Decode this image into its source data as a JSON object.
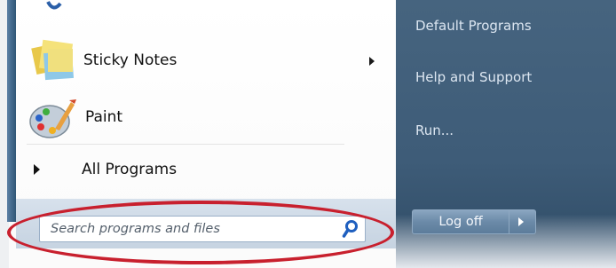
{
  "programs": {
    "sticky_notes": {
      "label": "Sticky Notes",
      "icon": "sticky-notes-icon"
    },
    "paint": {
      "label": "Paint",
      "icon": "paint-palette-icon"
    },
    "all_programs": {
      "label": "All Programs"
    }
  },
  "search": {
    "placeholder": "Search programs and files",
    "value": ""
  },
  "right_pane": {
    "links": [
      "Default Programs",
      "Help and Support",
      "Run..."
    ]
  },
  "shutdown": {
    "label": "Log off"
  },
  "colors": {
    "right_pane": "#3e5c78",
    "highlight_ellipse": "#c8202e",
    "search_border": "#9bb0c8"
  }
}
